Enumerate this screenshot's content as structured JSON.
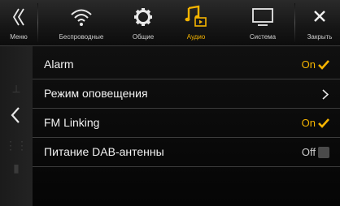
{
  "topbar": {
    "menu_label": "Меню",
    "tabs": [
      {
        "label": "Беспроводные",
        "icon": "wifi-icon"
      },
      {
        "label": "Общие",
        "icon": "gear-icon"
      },
      {
        "label": "Аудио",
        "icon": "music-icon",
        "active": true
      },
      {
        "label": "Система",
        "icon": "monitor-icon"
      }
    ],
    "close_label": "Закрыть"
  },
  "settings": [
    {
      "label": "Alarm",
      "value": "On",
      "state": "on"
    },
    {
      "label": "Режим оповещения",
      "type": "submenu"
    },
    {
      "label": "FM Linking",
      "value": "On",
      "state": "on"
    },
    {
      "label": "Питание DAB-антенны",
      "value": "Off",
      "state": "off"
    }
  ],
  "colors": {
    "accent": "#f5b400",
    "text": "#f2f2f2",
    "background": "#000000"
  }
}
